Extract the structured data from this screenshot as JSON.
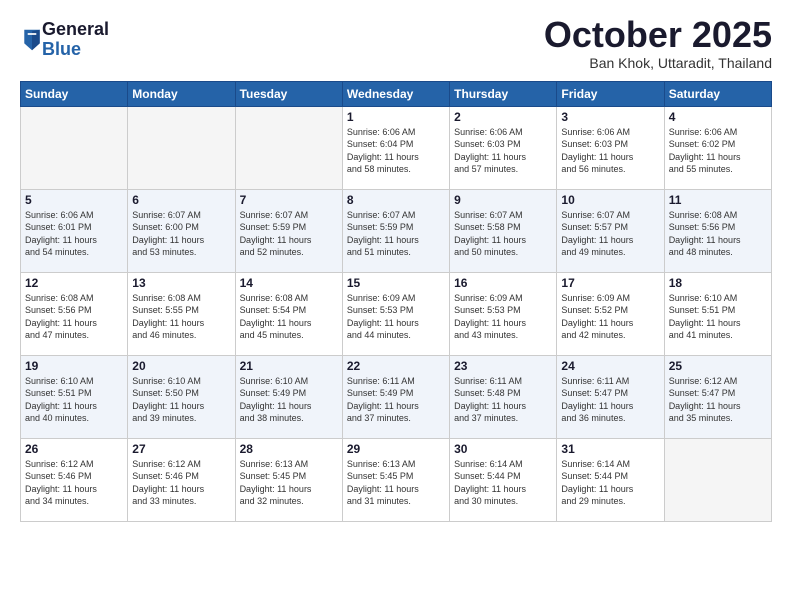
{
  "header": {
    "logo_general": "General",
    "logo_blue": "Blue",
    "month": "October 2025",
    "location": "Ban Khok, Uttaradit, Thailand"
  },
  "days_of_week": [
    "Sunday",
    "Monday",
    "Tuesday",
    "Wednesday",
    "Thursday",
    "Friday",
    "Saturday"
  ],
  "weeks": [
    [
      {
        "day": "",
        "empty": true
      },
      {
        "day": "",
        "empty": true
      },
      {
        "day": "",
        "empty": true
      },
      {
        "day": "1",
        "sunrise": "6:06 AM",
        "sunset": "6:04 PM",
        "daylight": "11 hours and 58 minutes."
      },
      {
        "day": "2",
        "sunrise": "6:06 AM",
        "sunset": "6:03 PM",
        "daylight": "11 hours and 57 minutes."
      },
      {
        "day": "3",
        "sunrise": "6:06 AM",
        "sunset": "6:03 PM",
        "daylight": "11 hours and 56 minutes."
      },
      {
        "day": "4",
        "sunrise": "6:06 AM",
        "sunset": "6:02 PM",
        "daylight": "11 hours and 55 minutes."
      }
    ],
    [
      {
        "day": "5",
        "sunrise": "6:06 AM",
        "sunset": "6:01 PM",
        "daylight": "11 hours and 54 minutes."
      },
      {
        "day": "6",
        "sunrise": "6:07 AM",
        "sunset": "6:00 PM",
        "daylight": "11 hours and 53 minutes."
      },
      {
        "day": "7",
        "sunrise": "6:07 AM",
        "sunset": "5:59 PM",
        "daylight": "11 hours and 52 minutes."
      },
      {
        "day": "8",
        "sunrise": "6:07 AM",
        "sunset": "5:59 PM",
        "daylight": "11 hours and 51 minutes."
      },
      {
        "day": "9",
        "sunrise": "6:07 AM",
        "sunset": "5:58 PM",
        "daylight": "11 hours and 50 minutes."
      },
      {
        "day": "10",
        "sunrise": "6:07 AM",
        "sunset": "5:57 PM",
        "daylight": "11 hours and 49 minutes."
      },
      {
        "day": "11",
        "sunrise": "6:08 AM",
        "sunset": "5:56 PM",
        "daylight": "11 hours and 48 minutes."
      }
    ],
    [
      {
        "day": "12",
        "sunrise": "6:08 AM",
        "sunset": "5:56 PM",
        "daylight": "11 hours and 47 minutes."
      },
      {
        "day": "13",
        "sunrise": "6:08 AM",
        "sunset": "5:55 PM",
        "daylight": "11 hours and 46 minutes."
      },
      {
        "day": "14",
        "sunrise": "6:08 AM",
        "sunset": "5:54 PM",
        "daylight": "11 hours and 45 minutes."
      },
      {
        "day": "15",
        "sunrise": "6:09 AM",
        "sunset": "5:53 PM",
        "daylight": "11 hours and 44 minutes."
      },
      {
        "day": "16",
        "sunrise": "6:09 AM",
        "sunset": "5:53 PM",
        "daylight": "11 hours and 43 minutes."
      },
      {
        "day": "17",
        "sunrise": "6:09 AM",
        "sunset": "5:52 PM",
        "daylight": "11 hours and 42 minutes."
      },
      {
        "day": "18",
        "sunrise": "6:10 AM",
        "sunset": "5:51 PM",
        "daylight": "11 hours and 41 minutes."
      }
    ],
    [
      {
        "day": "19",
        "sunrise": "6:10 AM",
        "sunset": "5:51 PM",
        "daylight": "11 hours and 40 minutes."
      },
      {
        "day": "20",
        "sunrise": "6:10 AM",
        "sunset": "5:50 PM",
        "daylight": "11 hours and 39 minutes."
      },
      {
        "day": "21",
        "sunrise": "6:10 AM",
        "sunset": "5:49 PM",
        "daylight": "11 hours and 38 minutes."
      },
      {
        "day": "22",
        "sunrise": "6:11 AM",
        "sunset": "5:49 PM",
        "daylight": "11 hours and 37 minutes."
      },
      {
        "day": "23",
        "sunrise": "6:11 AM",
        "sunset": "5:48 PM",
        "daylight": "11 hours and 37 minutes."
      },
      {
        "day": "24",
        "sunrise": "6:11 AM",
        "sunset": "5:47 PM",
        "daylight": "11 hours and 36 minutes."
      },
      {
        "day": "25",
        "sunrise": "6:12 AM",
        "sunset": "5:47 PM",
        "daylight": "11 hours and 35 minutes."
      }
    ],
    [
      {
        "day": "26",
        "sunrise": "6:12 AM",
        "sunset": "5:46 PM",
        "daylight": "11 hours and 34 minutes."
      },
      {
        "day": "27",
        "sunrise": "6:12 AM",
        "sunset": "5:46 PM",
        "daylight": "11 hours and 33 minutes."
      },
      {
        "day": "28",
        "sunrise": "6:13 AM",
        "sunset": "5:45 PM",
        "daylight": "11 hours and 32 minutes."
      },
      {
        "day": "29",
        "sunrise": "6:13 AM",
        "sunset": "5:45 PM",
        "daylight": "11 hours and 31 minutes."
      },
      {
        "day": "30",
        "sunrise": "6:14 AM",
        "sunset": "5:44 PM",
        "daylight": "11 hours and 30 minutes."
      },
      {
        "day": "31",
        "sunrise": "6:14 AM",
        "sunset": "5:44 PM",
        "daylight": "11 hours and 29 minutes."
      },
      {
        "day": "",
        "empty": true
      }
    ]
  ]
}
